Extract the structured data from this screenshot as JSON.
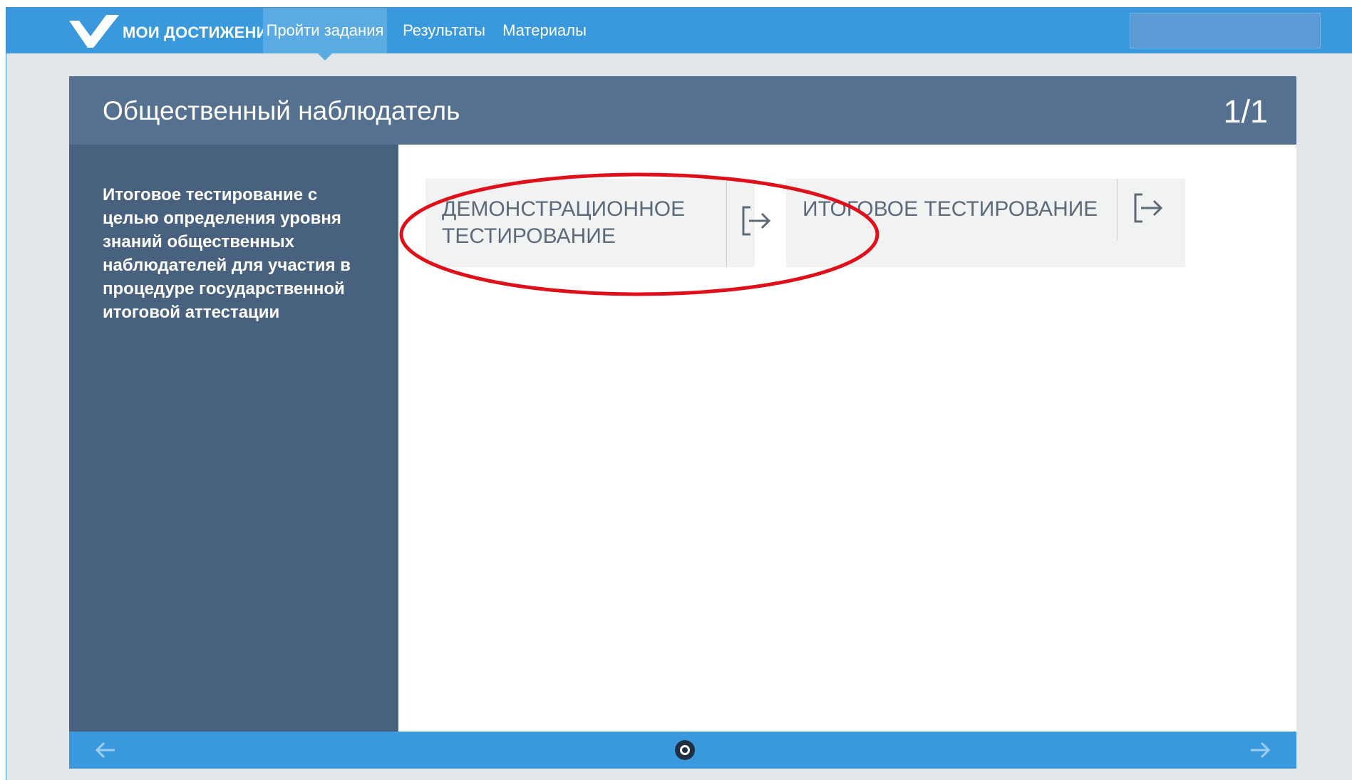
{
  "nav": {
    "brand": "МОИ ДОСТИЖЕНИЯ",
    "tabs": [
      {
        "label": "Пройти задания",
        "active": true
      },
      {
        "label": "Результаты",
        "active": false
      },
      {
        "label": "Материалы",
        "active": false
      }
    ]
  },
  "card": {
    "title": "Общественный наблюдатель",
    "counter": "1/1",
    "description": "Итоговое тестирование с целью определения уровня знаний общественных наблюдателей для участия в процедуре государственной итоговой аттестации",
    "buttons": [
      {
        "line1": "ДЕМОНСТРАЦИОННОЕ",
        "line2": "ТЕСТИРОВАНИЕ",
        "icon": "enter-arrow-icon",
        "highlighted": true
      },
      {
        "line1": "ИТОГОВОЕ ТЕСТИРОВАНИЕ",
        "icon": "enter-arrow-icon",
        "highlighted": false
      }
    ]
  },
  "footer": {
    "prev_icon": "arrow-left-icon",
    "next_icon": "arrow-right-icon",
    "page_dots": 1,
    "current_dot": 1
  },
  "colors": {
    "nav_bg": "#3a99dc",
    "card_header": "#55718f",
    "card_side": "#48617f",
    "highlight": "#e0101a"
  }
}
